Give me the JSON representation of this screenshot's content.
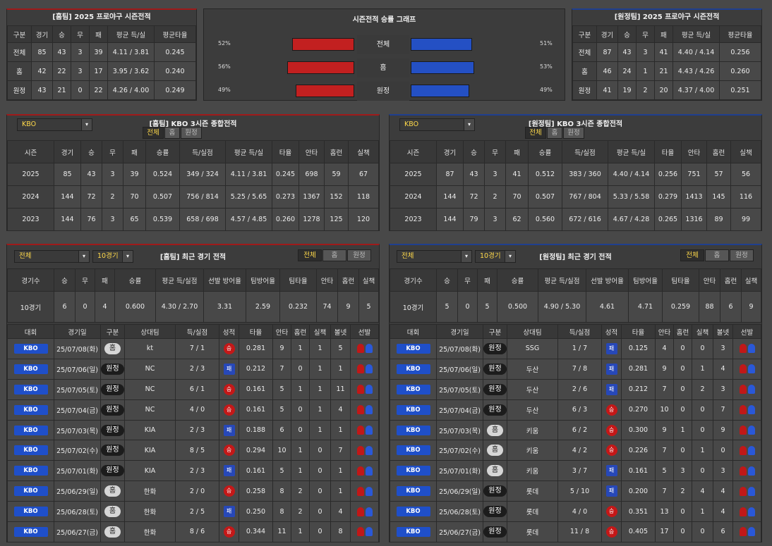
{
  "season_home": {
    "title": "[홈팀] 2025 프로야구 시즌전적",
    "headers": [
      "구분",
      "경기",
      "승",
      "무",
      "패",
      "평균 득/실",
      "평균타율"
    ],
    "rows": [
      [
        "전체",
        "85",
        "43",
        "3",
        "39",
        "4.11 / 3.81",
        "0.245"
      ],
      [
        "홈",
        "42",
        "22",
        "3",
        "17",
        "3.95 / 3.62",
        "0.240"
      ],
      [
        "원정",
        "43",
        "21",
        "0",
        "22",
        "4.26 / 4.00",
        "0.249"
      ]
    ]
  },
  "graph": {
    "title": "시즌전적 승률 그래프",
    "rows": [
      {
        "label": "전체",
        "home_pct": "52%",
        "away_pct": "51%",
        "home": 52,
        "away": 51
      },
      {
        "label": "홈",
        "home_pct": "56%",
        "away_pct": "53%",
        "home": 56,
        "away": 53
      },
      {
        "label": "원정",
        "home_pct": "49%",
        "away_pct": "49%",
        "home": 49,
        "away": 49
      }
    ]
  },
  "season_away": {
    "title": "[원정팀] 2025 프로야구 시즌전적",
    "headers": [
      "구분",
      "경기",
      "승",
      "무",
      "패",
      "평균 득/실",
      "평균타율"
    ],
    "rows": [
      [
        "전체",
        "87",
        "43",
        "3",
        "41",
        "4.40 / 4.14",
        "0.256"
      ],
      [
        "홈",
        "46",
        "24",
        "1",
        "21",
        "4.43 / 4.26",
        "0.260"
      ],
      [
        "원정",
        "41",
        "19",
        "2",
        "20",
        "4.37 / 4.00",
        "0.251"
      ]
    ]
  },
  "three_home": {
    "title": "[홈팀] KBO 3시즌 종합전적",
    "select": "KBO",
    "tabs": [
      "전체",
      "홈",
      "원정"
    ],
    "headers": [
      "시즌",
      "경기",
      "승",
      "무",
      "패",
      "승률",
      "득/실점",
      "평균 득/실",
      "타율",
      "안타",
      "홈런",
      "실책"
    ],
    "rows": [
      [
        "2025",
        "85",
        "43",
        "3",
        "39",
        "0.524",
        "349 / 324",
        "4.11 / 3.81",
        "0.245",
        "698",
        "59",
        "67"
      ],
      [
        "2024",
        "144",
        "72",
        "2",
        "70",
        "0.507",
        "756 / 814",
        "5.25 / 5.65",
        "0.273",
        "1367",
        "152",
        "118"
      ],
      [
        "2023",
        "144",
        "76",
        "3",
        "65",
        "0.539",
        "658 / 698",
        "4.57 / 4.85",
        "0.260",
        "1278",
        "125",
        "120"
      ]
    ]
  },
  "three_away": {
    "title": "[원정팀] KBO 3시즌 종합전적",
    "select": "KBO",
    "tabs": [
      "전체",
      "홈",
      "원정"
    ],
    "headers": [
      "시즌",
      "경기",
      "승",
      "무",
      "패",
      "승률",
      "득/실점",
      "평균 득/실",
      "타율",
      "안타",
      "홈런",
      "실책"
    ],
    "rows": [
      [
        "2025",
        "87",
        "43",
        "3",
        "41",
        "0.512",
        "383 / 360",
        "4.40 / 4.14",
        "0.256",
        "751",
        "57",
        "56"
      ],
      [
        "2024",
        "144",
        "72",
        "2",
        "70",
        "0.507",
        "767 / 804",
        "5.33 / 5.58",
        "0.279",
        "1413",
        "145",
        "116"
      ],
      [
        "2023",
        "144",
        "79",
        "3",
        "62",
        "0.560",
        "672 / 616",
        "4.67 / 4.28",
        "0.265",
        "1316",
        "89",
        "99"
      ]
    ]
  },
  "recent_home": {
    "title": "[홈팀] 최근 경기 전적",
    "select1": "전체",
    "select2": "10경기",
    "tabs": [
      "전체",
      "홈",
      "원정"
    ],
    "sum_headers": [
      "경기수",
      "승",
      "무",
      "패",
      "승률",
      "평균 득/실점",
      "선발 방어율",
      "팀방어율",
      "팀타율",
      "안타",
      "홈런",
      "실책"
    ],
    "sum_row": [
      "10경기",
      "6",
      "0",
      "4",
      "0.600",
      "4.30 / 2.70",
      "3.31",
      "2.59",
      "0.232",
      "74",
      "9",
      "5"
    ],
    "game_headers": [
      "대회",
      "경기일",
      "구분",
      "상대팀",
      "득/실점",
      "성적",
      "타율",
      "안타",
      "홈런",
      "실책",
      "볼넷",
      "선발"
    ],
    "games": [
      {
        "league": "KBO",
        "date": "25/07/08(화)",
        "venue": "홈",
        "opp": "kt",
        "score": "7 / 1",
        "result": "승",
        "avg": "0.281",
        "h": "9",
        "hr": "1",
        "e": "1",
        "bb": "5"
      },
      {
        "league": "KBO",
        "date": "25/07/06(일)",
        "venue": "원정",
        "opp": "NC",
        "score": "2 / 3",
        "result": "패",
        "avg": "0.212",
        "h": "7",
        "hr": "0",
        "e": "1",
        "bb": "1"
      },
      {
        "league": "KBO",
        "date": "25/07/05(토)",
        "venue": "원정",
        "opp": "NC",
        "score": "6 / 1",
        "result": "승",
        "avg": "0.161",
        "h": "5",
        "hr": "1",
        "e": "1",
        "bb": "11"
      },
      {
        "league": "KBO",
        "date": "25/07/04(금)",
        "venue": "원정",
        "opp": "NC",
        "score": "4 / 0",
        "result": "승",
        "avg": "0.161",
        "h": "5",
        "hr": "0",
        "e": "1",
        "bb": "4"
      },
      {
        "league": "KBO",
        "date": "25/07/03(목)",
        "venue": "원정",
        "opp": "KIA",
        "score": "2 / 3",
        "result": "패",
        "avg": "0.188",
        "h": "6",
        "hr": "0",
        "e": "1",
        "bb": "1"
      },
      {
        "league": "KBO",
        "date": "25/07/02(수)",
        "venue": "원정",
        "opp": "KIA",
        "score": "8 / 5",
        "result": "승",
        "avg": "0.294",
        "h": "10",
        "hr": "1",
        "e": "0",
        "bb": "7"
      },
      {
        "league": "KBO",
        "date": "25/07/01(화)",
        "venue": "원정",
        "opp": "KIA",
        "score": "2 / 3",
        "result": "패",
        "avg": "0.161",
        "h": "5",
        "hr": "1",
        "e": "0",
        "bb": "1"
      },
      {
        "league": "KBO",
        "date": "25/06/29(일)",
        "venue": "홈",
        "opp": "한화",
        "score": "2 / 0",
        "result": "승",
        "avg": "0.258",
        "h": "8",
        "hr": "2",
        "e": "0",
        "bb": "1"
      },
      {
        "league": "KBO",
        "date": "25/06/28(토)",
        "venue": "홈",
        "opp": "한화",
        "score": "2 / 5",
        "result": "패",
        "avg": "0.250",
        "h": "8",
        "hr": "2",
        "e": "0",
        "bb": "4"
      },
      {
        "league": "KBO",
        "date": "25/06/27(금)",
        "venue": "홈",
        "opp": "한화",
        "score": "8 / 6",
        "result": "승",
        "avg": "0.344",
        "h": "11",
        "hr": "1",
        "e": "0",
        "bb": "8"
      }
    ]
  },
  "recent_away": {
    "title": "[원정팀] 최근 경기 전적",
    "select1": "전체",
    "select2": "10경기",
    "tabs": [
      "전체",
      "홈",
      "원정"
    ],
    "sum_headers": [
      "경기수",
      "승",
      "무",
      "패",
      "승률",
      "평균 득/실점",
      "선발 방어율",
      "팀방어율",
      "팀타율",
      "안타",
      "홈런",
      "실책"
    ],
    "sum_row": [
      "10경기",
      "5",
      "0",
      "5",
      "0.500",
      "4.90 / 5.30",
      "4.61",
      "4.71",
      "0.259",
      "88",
      "6",
      "9"
    ],
    "game_headers": [
      "대회",
      "경기일",
      "구분",
      "상대팀",
      "득/실점",
      "성적",
      "타율",
      "안타",
      "홈런",
      "실책",
      "볼넷",
      "선발"
    ],
    "games": [
      {
        "league": "KBO",
        "date": "25/07/08(화)",
        "venue": "원정",
        "opp": "SSG",
        "score": "1 / 7",
        "result": "패",
        "avg": "0.125",
        "h": "4",
        "hr": "0",
        "e": "0",
        "bb": "3"
      },
      {
        "league": "KBO",
        "date": "25/07/06(일)",
        "venue": "원정",
        "opp": "두산",
        "score": "7 / 8",
        "result": "패",
        "avg": "0.281",
        "h": "9",
        "hr": "0",
        "e": "1",
        "bb": "4"
      },
      {
        "league": "KBO",
        "date": "25/07/05(토)",
        "venue": "원정",
        "opp": "두산",
        "score": "2 / 6",
        "result": "패",
        "avg": "0.212",
        "h": "7",
        "hr": "0",
        "e": "2",
        "bb": "3"
      },
      {
        "league": "KBO",
        "date": "25/07/04(금)",
        "venue": "원정",
        "opp": "두산",
        "score": "6 / 3",
        "result": "승",
        "avg": "0.270",
        "h": "10",
        "hr": "0",
        "e": "0",
        "bb": "7"
      },
      {
        "league": "KBO",
        "date": "25/07/03(목)",
        "venue": "홈",
        "opp": "키움",
        "score": "6 / 2",
        "result": "승",
        "avg": "0.300",
        "h": "9",
        "hr": "1",
        "e": "0",
        "bb": "9"
      },
      {
        "league": "KBO",
        "date": "25/07/02(수)",
        "venue": "홈",
        "opp": "키움",
        "score": "4 / 2",
        "result": "승",
        "avg": "0.226",
        "h": "7",
        "hr": "0",
        "e": "1",
        "bb": "0"
      },
      {
        "league": "KBO",
        "date": "25/07/01(화)",
        "venue": "홈",
        "opp": "키움",
        "score": "3 / 7",
        "result": "패",
        "avg": "0.161",
        "h": "5",
        "hr": "3",
        "e": "0",
        "bb": "3"
      },
      {
        "league": "KBO",
        "date": "25/06/29(일)",
        "venue": "원정",
        "opp": "롯데",
        "score": "5 / 10",
        "result": "패",
        "avg": "0.200",
        "h": "7",
        "hr": "2",
        "e": "4",
        "bb": "4"
      },
      {
        "league": "KBO",
        "date": "25/06/28(토)",
        "venue": "원정",
        "opp": "롯데",
        "score": "4 / 0",
        "result": "승",
        "avg": "0.351",
        "h": "13",
        "hr": "0",
        "e": "1",
        "bb": "4"
      },
      {
        "league": "KBO",
        "date": "25/06/27(금)",
        "venue": "원정",
        "opp": "롯데",
        "score": "11 / 8",
        "result": "승",
        "avg": "0.405",
        "h": "17",
        "hr": "0",
        "e": "0",
        "bb": "6"
      }
    ]
  }
}
